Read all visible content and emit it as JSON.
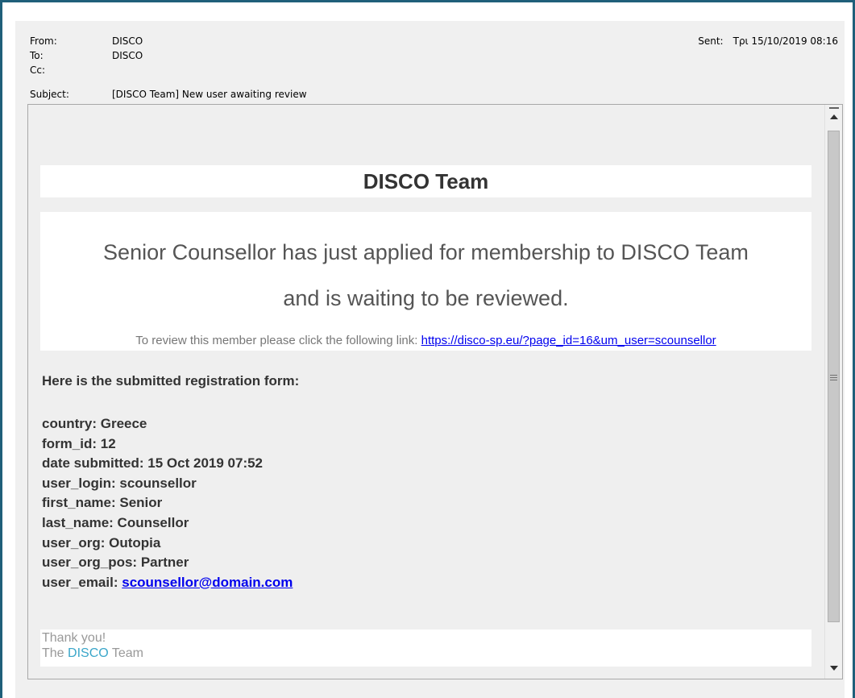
{
  "header": {
    "from_label": "From:",
    "from_value": "DISCO",
    "to_label": "To:",
    "to_value": "DISCO",
    "cc_label": "Cc:",
    "cc_value": "",
    "subject_label": "Subject:",
    "subject_value": "[DISCO Team] New user awaiting review",
    "sent_label": "Sent:",
    "sent_value": "Τρι 15/10/2019 08:16"
  },
  "message": {
    "team_title": "DISCO Team",
    "intro_line1": "Senior Counsellor has just applied for membership to DISCO Team",
    "intro_line2": "and is waiting to be reviewed.",
    "review_text": "To review this member please click the following link: ",
    "review_link": "https://disco-sp.eu/?page_id=16&um_user=scounsellor",
    "form_title": "Here is the submitted registration form:",
    "fields": [
      {
        "label": "country: ",
        "value": "Greece"
      },
      {
        "label": "form_id: ",
        "value": "12"
      },
      {
        "label": "date submitted: ",
        "value": "15 Oct 2019 07:52"
      },
      {
        "label": "user_login: ",
        "value": "scounsellor"
      },
      {
        "label": "first_name: ",
        "value": "Senior"
      },
      {
        "label": "last_name: ",
        "value": "Counsellor"
      },
      {
        "label": "user_org: ",
        "value": "Outopia"
      },
      {
        "label": "user_org_pos: ",
        "value": "Partner"
      }
    ],
    "email_label": "user_email: ",
    "email_value": "scounsellor@domain.com",
    "thanks_line": "Thank you!",
    "signoff_prefix": "The ",
    "signoff_brand": "DISCO",
    "signoff_suffix": " Team"
  },
  "colors": {
    "frame_border": "#1f5f7a",
    "link": "#0000ee",
    "brand": "#3aa6c9"
  },
  "icons": [
    "scroll-up-arrow-icon",
    "scroll-down-arrow-icon",
    "scroll-grip-icon"
  ]
}
